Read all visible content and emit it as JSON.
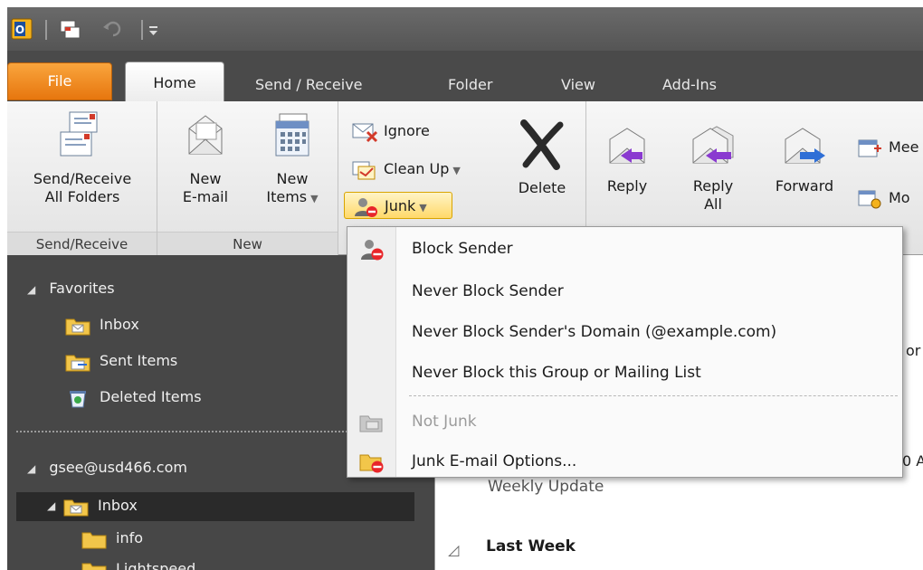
{
  "tabs": {
    "file": "File",
    "home": "Home",
    "send_receive": "Send / Receive",
    "folder": "Folder",
    "view": "View",
    "addins": "Add-Ins"
  },
  "ribbon": {
    "send_receive_group": {
      "button": [
        "Send/Receive",
        "All Folders"
      ],
      "label": "Send/Receive"
    },
    "new_group": {
      "new_email": [
        "New",
        "E-mail"
      ],
      "new_items": [
        "New",
        "Items"
      ],
      "label": "New"
    },
    "delete_group": {
      "ignore": "Ignore",
      "clean_up": "Clean Up",
      "junk": "Junk",
      "delete": "Delete"
    },
    "respond_group": {
      "reply": "Reply",
      "reply_all": [
        "Reply",
        "All"
      ],
      "forward": "Forward",
      "meeting": "Mee",
      "more": "Mo"
    }
  },
  "nav": {
    "favorites": "Favorites",
    "favorites_items": [
      "Inbox",
      "Sent Items",
      "Deleted Items"
    ],
    "account": "gsee@usd466.com",
    "account_items": [
      "Inbox",
      "info",
      "Lightspeed"
    ]
  },
  "content": {
    "partial_top": "or",
    "partial_time": "0 A",
    "subject": "Weekly Update",
    "group_header": "Last Week"
  },
  "junk_menu": {
    "items": [
      {
        "label": "Block Sender",
        "enabled": true
      },
      {
        "label": "Never Block Sender",
        "enabled": true
      },
      {
        "label": "Never Block Sender's Domain (@example.com)",
        "enabled": true
      },
      {
        "label": "Never Block this Group or Mailing List",
        "enabled": true
      },
      {
        "label": "Not Junk",
        "enabled": false
      },
      {
        "label": "Junk E-mail Options...",
        "enabled": true
      }
    ]
  },
  "colors": {
    "file_tab": "#e7760e",
    "junk_highlight": "#ffd96a",
    "nav_background": "#474747",
    "selection": "#2a2a2a"
  }
}
